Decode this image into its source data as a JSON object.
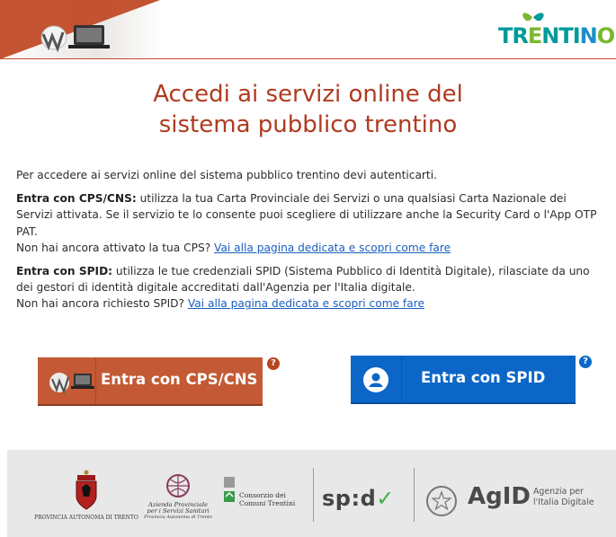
{
  "header": {
    "logo_alt": "CPS",
    "brand_parts": [
      "TR",
      "E",
      "NTI",
      "N",
      "O"
    ]
  },
  "title": {
    "line1": "Accedi ai servizi online del",
    "line2": "sistema pubblico trentino"
  },
  "intro": "Per accedere ai servizi online del sistema pubblico trentino devi autenticarti.",
  "cps_section": {
    "bold": "Entra con CPS/CNS:",
    "text": " utilizza la tua Carta Provinciale dei Servizi o una qualsiasi Carta Nazionale dei Servizi attivata. Se il servizio te lo consente puoi scegliere di utilizzare anche la Security Card o l'App OTP PAT.",
    "question": "Non hai ancora attivato la tua CPS?",
    "link": "Vai alla pagina dedicata e scopri come fare"
  },
  "spid_section": {
    "bold": "Entra con SPID:",
    "text": " utilizza le tue credenziali SPID (Sistema Pubblico di Identità Digitale), rilasciate da uno dei gestori di identità digitale accreditati dall'Agenzia per l'Italia digitale.",
    "question": "Non hai ancora richiesto SPID?",
    "link": "Vai alla pagina dedicata e scopri come fare"
  },
  "buttons": {
    "cps": "Entra con CPS/CNS",
    "spid": "Entra con SPID",
    "help": "?"
  },
  "footer": {
    "pat": "PROVINCIA AUTONOMA DI TRENTO",
    "apss_line1": "Azienda Provinciale",
    "apss_line2": "per i Servizi Sanitari",
    "apss_line3": "Provincia Autonoma di Trento",
    "consorzio_line1": "Consorzio dei",
    "consorzio_line2": "Comuni Trentini",
    "spid_prefix": "sp",
    "spid_dot": ":",
    "spid_d": "d",
    "spid_check": "✓",
    "agid": "AgID",
    "agid_sub1": "Agenzia per",
    "agid_sub2": "l'Italia Digitale"
  },
  "colors": {
    "title": "#b03a20",
    "cps_button": "#c35a35",
    "spid_button": "#0b66c8",
    "link": "#1a5fbf"
  }
}
